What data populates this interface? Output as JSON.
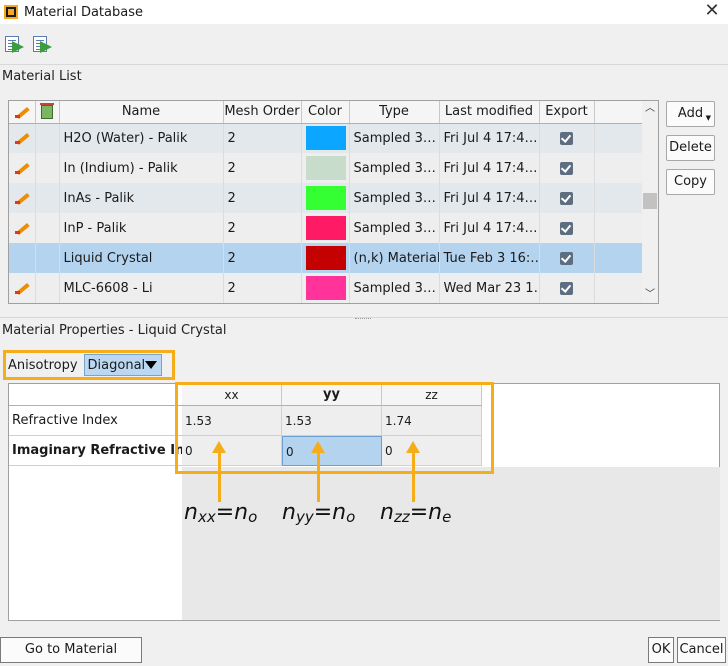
{
  "window": {
    "title": "Material Database",
    "close_glyph": "✕"
  },
  "toolbar": {
    "icons": [
      "import-icon",
      "export-icon"
    ]
  },
  "material_list": {
    "label": "Material List",
    "columns": [
      "Name",
      "Mesh Order",
      "Color",
      "Type",
      "Last modified",
      "Export"
    ],
    "rows": [
      {
        "name": "H2O (Water) - Palik",
        "mesh_order": "2",
        "color": "#0aa6ff",
        "type": "Sampled 3…",
        "modified": "Fri Jul 4 17:4…",
        "export": true,
        "editable": true,
        "selected": false
      },
      {
        "name": "In (Indium) - Palik",
        "mesh_order": "2",
        "color": "#c8dccc",
        "type": "Sampled 3…",
        "modified": "Fri Jul 4 17:4…",
        "export": true,
        "editable": true,
        "selected": false
      },
      {
        "name": "InAs - Palik",
        "mesh_order": "2",
        "color": "#33ff33",
        "type": "Sampled 3…",
        "modified": "Fri Jul 4 17:4…",
        "export": true,
        "editable": true,
        "selected": false
      },
      {
        "name": "InP - Palik",
        "mesh_order": "2",
        "color": "#ff1a66",
        "type": "Sampled 3…",
        "modified": "Fri Jul 4 17:4…",
        "export": true,
        "editable": true,
        "selected": false
      },
      {
        "name": "Liquid Crystal",
        "mesh_order": "2",
        "color": "#c40000",
        "type": "(n,k) Material",
        "modified": "Tue Feb 3 16:…",
        "export": true,
        "editable": false,
        "selected": true
      },
      {
        "name": "MLC-6608 - Li",
        "mesh_order": "2",
        "color": "#ff3399",
        "type": "Sampled 3…",
        "modified": "Wed Mar 23 1…",
        "export": true,
        "editable": true,
        "selected": false
      }
    ],
    "buttons": {
      "add": "Add",
      "delete": "Delete",
      "copy": "Copy"
    }
  },
  "material_properties": {
    "label": "Material Properties - Liquid Crystal",
    "anisotropy_label": "Anisotropy",
    "anisotropy_value": "Diagonal",
    "columns": [
      "xx",
      "yy",
      "zz"
    ],
    "rows": [
      {
        "label": "Refractive Index",
        "values": [
          "1.53",
          "1.53",
          "1.74"
        ]
      },
      {
        "label": "Imaginary Refractive Index",
        "values": [
          "0",
          "0",
          "0"
        ]
      }
    ],
    "selected_cell": "imag-yy"
  },
  "annotations": [
    {
      "base": "n",
      "sub": "xx",
      "eq": "=",
      "base2": "n",
      "sub2": "o"
    },
    {
      "base": "n",
      "sub": "yy",
      "eq": "=",
      "base2": "n",
      "sub2": "o"
    },
    {
      "base": "n",
      "sub": "zz",
      "eq": "=",
      "base2": "n",
      "sub2": "e"
    }
  ],
  "footer": {
    "explorer": "Go to Material Explorer",
    "ok": "OK",
    "cancel": "Cancel"
  },
  "colors": {
    "highlight": "#f5ad1a",
    "selection": "#b4d3ef"
  }
}
